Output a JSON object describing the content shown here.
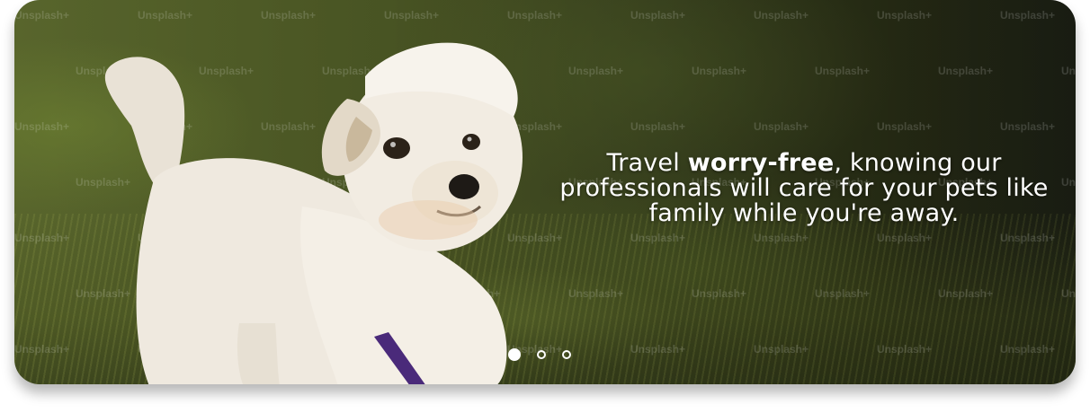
{
  "hero": {
    "image_alt": "Fluffy white dog standing in green grass",
    "watermark": "Unsplash+",
    "tagline": {
      "prefix": "Travel ",
      "emphasis": "worry-free",
      "suffix": ", knowing our professionals will care for your pets like family while you're away."
    }
  },
  "carousel": {
    "slide_count": 3,
    "active_index": 0,
    "dots": [
      "slide-1",
      "slide-2",
      "slide-3"
    ]
  },
  "colors": {
    "text": "#ffffff",
    "harness": "#4a2a7a"
  }
}
